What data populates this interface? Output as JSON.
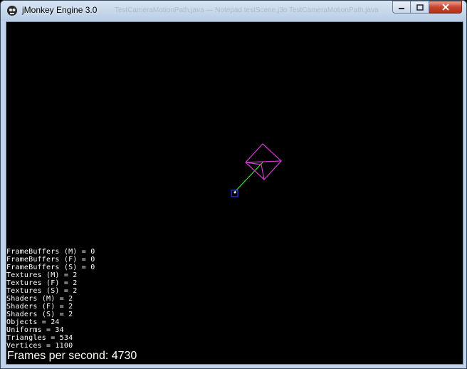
{
  "window": {
    "title": "jMonkey Engine 3.0",
    "background_tabs": "TestCameraMotionPath.java — Notepad   testScene.j3o   TestCameraMotionPath.java"
  },
  "colors": {
    "viewport_bg": "#000000",
    "cone_outline": "#d13ad1",
    "path_line": "#33ff33",
    "cube_marker": "#3333ff",
    "overlay_text": "#ffffff"
  },
  "stats": [
    "FrameBuffers (M) = 0",
    "FrameBuffers (F) = 0",
    "FrameBuffers (S) = 0",
    "Textures (M) = 2",
    "Textures (F) = 2",
    "Textures (S) = 2",
    "Shaders (M) = 2",
    "Shaders (F) = 2",
    "Shaders (S) = 2",
    "Objects = 24",
    "Uniforms = 34",
    "Triangles = 534",
    "Vertices = 1100"
  ],
  "fps_label": "Frames per second: 4730"
}
